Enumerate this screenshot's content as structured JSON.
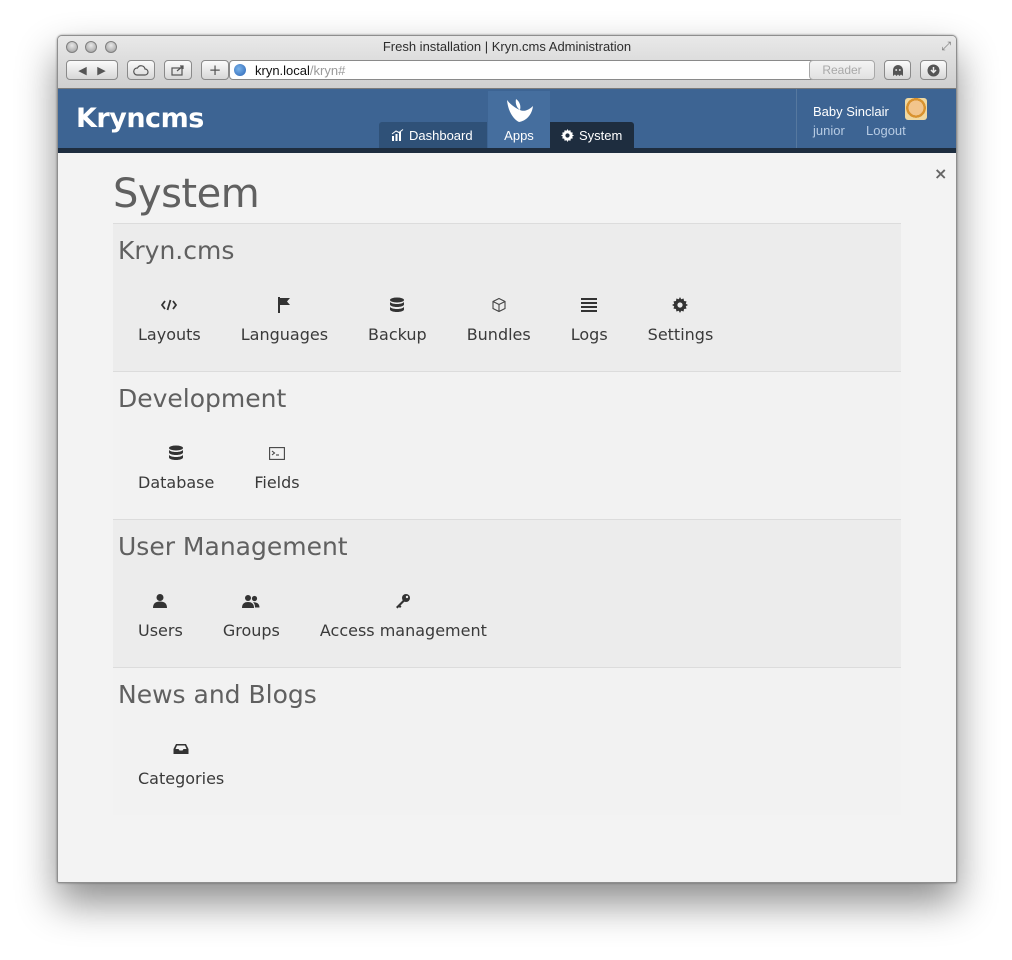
{
  "browser": {
    "title": "Fresh installation | Kryn.cms Administration",
    "url_host": "kryn.local",
    "url_path": "/kryn#",
    "reader_label": "Reader"
  },
  "header": {
    "logo": "Kryncms",
    "nav": {
      "dashboard": "Dashboard",
      "apps": "Apps",
      "system": "System"
    },
    "user": {
      "name": "Baby Sinclair",
      "login": "junior",
      "logout": "Logout"
    }
  },
  "page": {
    "title": "System",
    "close": "×"
  },
  "sections": [
    {
      "title": "Kryn.cms",
      "items": [
        {
          "label": "Layouts",
          "icon": "code-icon"
        },
        {
          "label": "Languages",
          "icon": "flag-icon"
        },
        {
          "label": "Backup",
          "icon": "database-icon"
        },
        {
          "label": "Bundles",
          "icon": "cube-icon"
        },
        {
          "label": "Logs",
          "icon": "list-icon"
        },
        {
          "label": "Settings",
          "icon": "gear-icon"
        }
      ]
    },
    {
      "title": "Development",
      "items": [
        {
          "label": "Database",
          "icon": "database-icon"
        },
        {
          "label": "Fields",
          "icon": "terminal-icon"
        }
      ]
    },
    {
      "title": "User Management",
      "items": [
        {
          "label": "Users",
          "icon": "user-icon"
        },
        {
          "label": "Groups",
          "icon": "users-icon"
        },
        {
          "label": "Access management",
          "icon": "key-icon"
        }
      ]
    },
    {
      "title": "News and Blogs",
      "items": [
        {
          "label": "Categories",
          "icon": "inbox-icon"
        }
      ]
    }
  ],
  "colors": {
    "header_bg": "#3d6493",
    "header_dark": "#1e2d3f",
    "content_bg": "#f3f3f3"
  }
}
